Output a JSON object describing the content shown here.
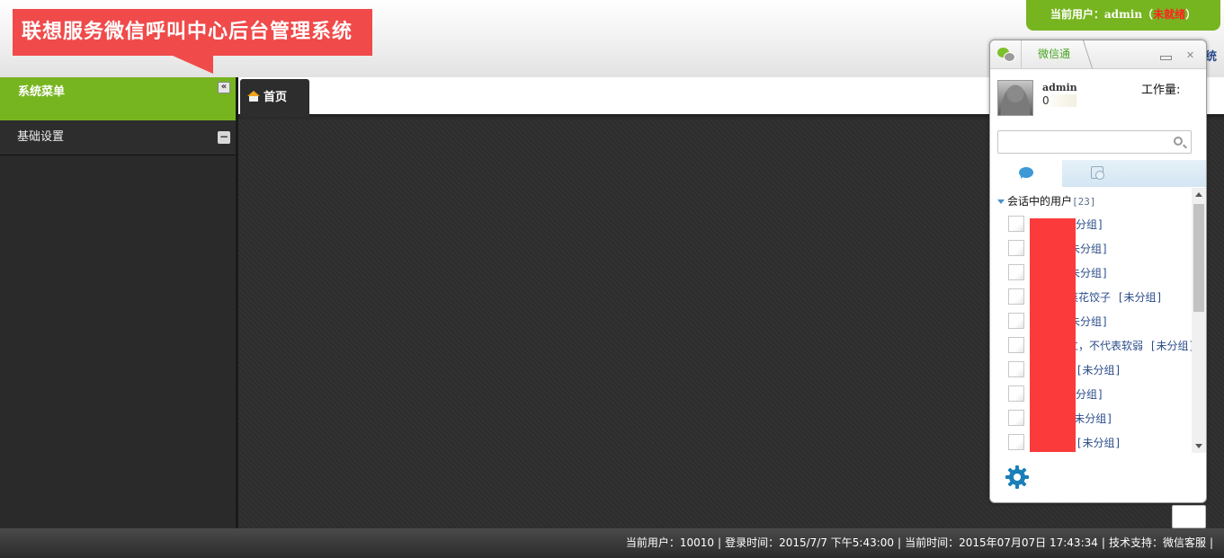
{
  "app": {
    "title": "联想服务微信呼叫中心后台管理系统",
    "current_user_label": "当前用户：admin（",
    "current_user_status": "未就绪",
    "current_user_close": "）",
    "header_edge_text": "统"
  },
  "sidebar": {
    "heading": "系统菜单",
    "collapse_glyph": "«",
    "items": [
      {
        "label": "基础设置",
        "toggle_glyph": "−"
      }
    ]
  },
  "tabs": [
    {
      "label": "首页",
      "icon": "home-icon"
    }
  ],
  "footer": {
    "user": "当前用户：10010",
    "login_time": "登录时间：2015/7/7 下午5:43:00",
    "current_time": "当前时间：2015年07月07日 17:43:34",
    "support": "技术支持：微信客服"
  },
  "chat": {
    "title": "微信通",
    "profile": {
      "name": "admin",
      "count": "0",
      "workload_label": "工作量:"
    },
    "search": {
      "placeholder": "",
      "value": ""
    },
    "group": {
      "label": "会话中的用户",
      "count": "[23]"
    },
    "users": [
      {
        "suffix": "分组]"
      },
      {
        "suffix": "未分组]"
      },
      {
        "suffix": "未分组]"
      },
      {
        "suffix": "菜花饺子 [未分组]"
      },
      {
        "suffix": "未分组]"
      },
      {
        "suffix": "立，不代表软弱 [未分组]"
      },
      {
        "suffix": " [未分组]"
      },
      {
        "suffix": "分组]"
      },
      {
        "suffix": "[未分组]"
      },
      {
        "suffix": " [未分组]"
      }
    ]
  },
  "colors": {
    "green": "#77b520",
    "title_red": "#f04a4a",
    "status_red": "#ff2222",
    "link_blue": "#2a4c8a",
    "gear_blue": "#1a7fb8"
  }
}
